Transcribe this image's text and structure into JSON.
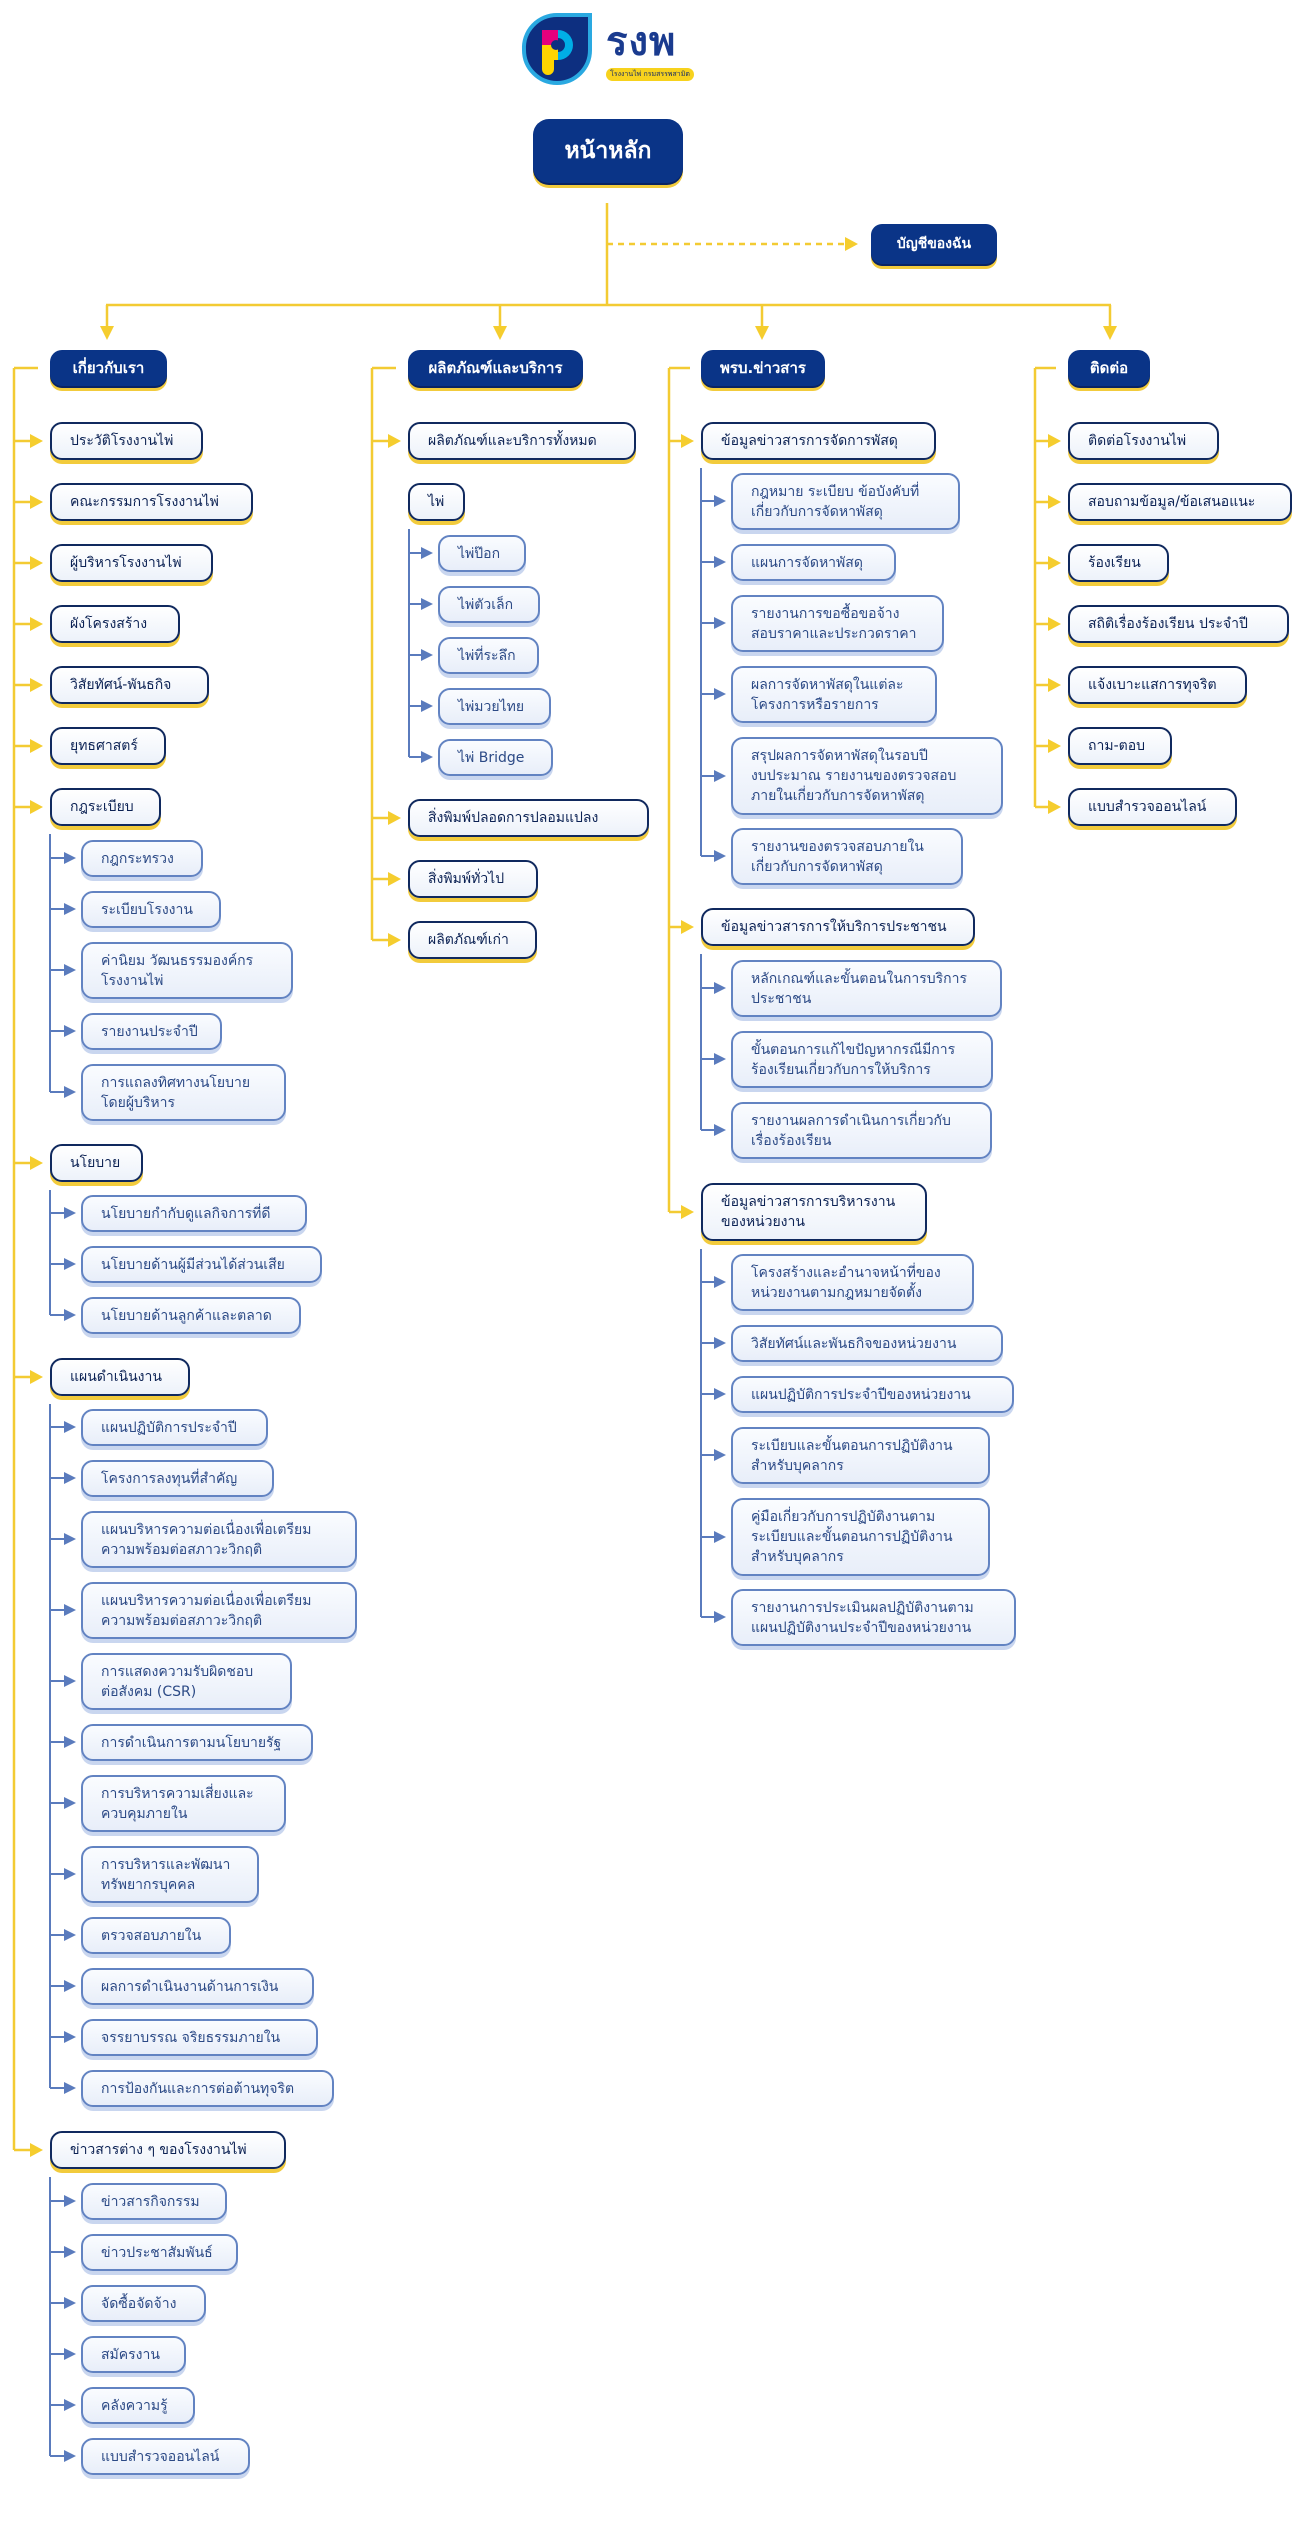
{
  "logo": {
    "wordmark": "รงพ",
    "tagline": "โรงงานไพ่ กรมสรรพสามิต"
  },
  "home": {
    "label": "หน้าหลัก"
  },
  "account": {
    "label": "บัญชีของฉัน"
  },
  "theme": {
    "navy": "#0a3487",
    "yellow": "#f4cc36",
    "sub_border_blue": "#6283c2"
  },
  "columns": [
    {
      "header": "เกี่ยวกับเรา",
      "items": [
        {
          "label": "ประวัติโรงงานไพ่"
        },
        {
          "label": "คณะกรรมการโรงงานไพ่"
        },
        {
          "label": "ผู้บริหารโรงงานไพ่"
        },
        {
          "label": "ผังโครงสร้าง"
        },
        {
          "label": "วิสัยทัศน์-พันธกิจ"
        },
        {
          "label": "ยุทธศาสตร์"
        },
        {
          "label": "กฎระเบียบ",
          "children": [
            {
              "label": "กฎกระทรวง"
            },
            {
              "label": "ระเบียบโรงงาน"
            },
            {
              "label": "ค่านิยม วัฒนธรรมองค์กร\nโรงงานไพ่"
            },
            {
              "label": "รายงานประจำปี"
            },
            {
              "label": "การแถลงทิศทางนโยบาย\nโดยผู้บริหาร"
            }
          ]
        },
        {
          "label": "นโยบาย",
          "children": [
            {
              "label": "นโยบายกำกับดูแลกิจการที่ดี"
            },
            {
              "label": "นโยบายด้านผู้มีส่วนได้ส่วนเสีย"
            },
            {
              "label": "นโยบายด้านลูกค้าและตลาด"
            }
          ]
        },
        {
          "label": "แผนดำเนินงาน",
          "children": [
            {
              "label": "แผนปฏิบัติการประจำปี"
            },
            {
              "label": "โครงการลงทุนที่สำคัญ"
            },
            {
              "label": "แผนบริหารความต่อเนื่องเพื่อเตรียม\nความพร้อมต่อสภาวะวิกฤติ"
            },
            {
              "label": "แผนบริหารความต่อเนื่องเพื่อเตรียม\nความพร้อมต่อสภาวะวิกฤติ"
            },
            {
              "label": "การแสดงความรับผิดชอบ\nต่อสังคม (CSR)"
            },
            {
              "label": "การดำเนินการตามนโยบายรัฐ"
            },
            {
              "label": "การบริหารความเสี่ยงและ\nควบคุมภายใน"
            },
            {
              "label": "การบริหารและพัฒนา\nทรัพยากรบุคคล"
            },
            {
              "label": "ตรวจสอบภายใน"
            },
            {
              "label": "ผลการดำเนินงานด้านการเงิน"
            },
            {
              "label": "จรรยาบรรณ จริยธรรมภายใน"
            },
            {
              "label": "การป้องกันและการต่อต้านทุจริต"
            }
          ]
        },
        {
          "label": "ข่าวสารต่าง ๆ ของโรงงานไพ่",
          "children": [
            {
              "label": "ข่าวสารกิจกรรม"
            },
            {
              "label": "ข่าวประชาสัมพันธ์"
            },
            {
              "label": "จัดซื้อจัดจ้าง"
            },
            {
              "label": "สมัครงาน"
            },
            {
              "label": "คลังความรู้"
            },
            {
              "label": "แบบสำรวจออนไลน์"
            }
          ]
        }
      ]
    },
    {
      "header": "ผลิตภัณฑ์และบริการ",
      "items": [
        {
          "label": "ผลิตภัณฑ์และบริการทั้งหมด"
        },
        {
          "label": "ไพ่",
          "children": [
            {
              "label": "ไพ่ป๊อก"
            },
            {
              "label": "ไพ่ตัวเล็ก"
            },
            {
              "label": "ไพ่ที่ระลึก"
            },
            {
              "label": "ไพ่มวยไทย"
            },
            {
              "label": "ไพ่ Bridge"
            }
          ]
        },
        {
          "label": "สิ่งพิมพ์ปลอดการปลอมแปลง"
        },
        {
          "label": "สิ่งพิมพ์ทั่วไป"
        },
        {
          "label": "ผลิตภัณฑ์เก่า"
        }
      ]
    },
    {
      "header": "พรบ.ข่าวสาร",
      "items": [
        {
          "label": "ข้อมูลข่าวสารการจัดการพัสดุ",
          "children": [
            {
              "label": "กฎหมาย ระเบียบ ข้อบังคับที่\nเกี่ยวกับการจัดหาพัสดุ"
            },
            {
              "label": "แผนการจัดหาพัสดุ"
            },
            {
              "label": "รายงานการขอซื้อขอจ้าง\nสอบราคาและประกวดราคา"
            },
            {
              "label": "ผลการจัดหาพัสดุในแต่ละ\nโครงการหรือรายการ"
            },
            {
              "label": "สรุปผลการจัดหาพัสดุในรอบปี\nงบประมาณ รายงานของตรวจสอบ\nภายในเกี่ยวกับการจัดหาพัสดุ"
            },
            {
              "label": "รายงานของตรวจสอบภายใน\nเกี่ยวกับการจัดหาพัสดุ"
            }
          ]
        },
        {
          "label": "ข้อมูลข่าวสารการให้บริการประชาชน",
          "children": [
            {
              "label": "หลักเกณฑ์และขั้นตอนในการบริการ\nประชาชน"
            },
            {
              "label": "ขั้นตอนการแก้ไขปัญหากรณีมีการ\nร้องเรียนเกี่ยวกับการให้บริการ"
            },
            {
              "label": "รายงานผลการดำเนินการเกี่ยวกับ\nเรื่องร้องเรียน"
            }
          ]
        },
        {
          "label": "ข้อมูลข่าวสารการบริหารงาน\nของหน่วยงาน",
          "children": [
            {
              "label": "โครงสร้างและอำนาจหน้าที่ของ\nหน่วยงานตามกฎหมายจัดตั้ง"
            },
            {
              "label": "วิสัยทัศน์และพันธกิจของหน่วยงาน"
            },
            {
              "label": "แผนปฏิบัติการประจำปีของหน่วยงาน"
            },
            {
              "label": "ระเบียบและขั้นตอนการปฏิบัติงาน\nสำหรับบุคลากร"
            },
            {
              "label": "คู่มือเกี่ยวกับการปฏิบัติงานตาม\nระเบียบและขั้นตอนการปฏิบัติงาน\nสำหรับบุคลากร"
            },
            {
              "label": "รายงานการประเมินผลปฏิบัติงานตาม\nแผนปฏิบัติงานประจำปีของหน่วยงาน"
            }
          ]
        }
      ]
    },
    {
      "header": "ติดต่อ",
      "items": [
        {
          "label": "ติดต่อโรงงานไพ่"
        },
        {
          "label": "สอบถามข้อมูล/ข้อเสนอแนะ"
        },
        {
          "label": "ร้องเรียน"
        },
        {
          "label": "สถิติเรื่องร้องเรียน ประจำปี"
        },
        {
          "label": "แจ้งเบาะแสการทุจริต"
        },
        {
          "label": "ถาม-ตอบ"
        },
        {
          "label": "แบบสำรวจออนไลน์"
        }
      ]
    }
  ]
}
